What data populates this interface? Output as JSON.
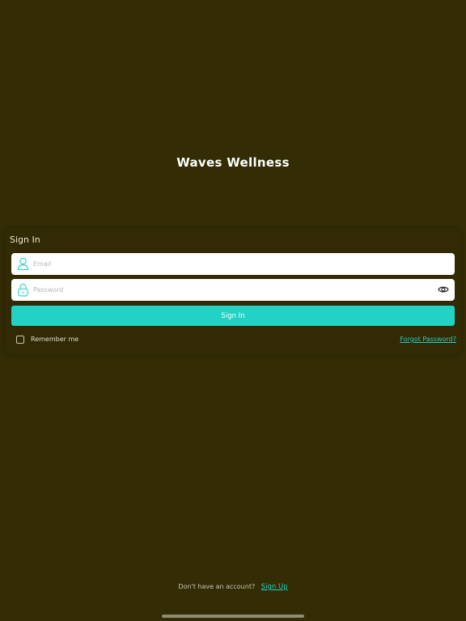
{
  "app": {
    "title": "Waves Wellness"
  },
  "signin": {
    "heading": "Sign In",
    "email": {
      "placeholder": "Email",
      "value": "",
      "icon": "user-icon"
    },
    "password": {
      "placeholder": "Password",
      "value": "",
      "icon": "lock-icon",
      "toggle_icon": "eye-icon"
    },
    "button_label": "Sign In",
    "remember_label": "Remember me",
    "remember_checked": false,
    "forgot_label": "Forgot Password?"
  },
  "footer": {
    "prompt": "Don't have an account?",
    "signup_label": "Sign Up"
  },
  "colors": {
    "background": "#332c05",
    "accent": "#22d3c5",
    "field_bg": "#ffffff"
  }
}
